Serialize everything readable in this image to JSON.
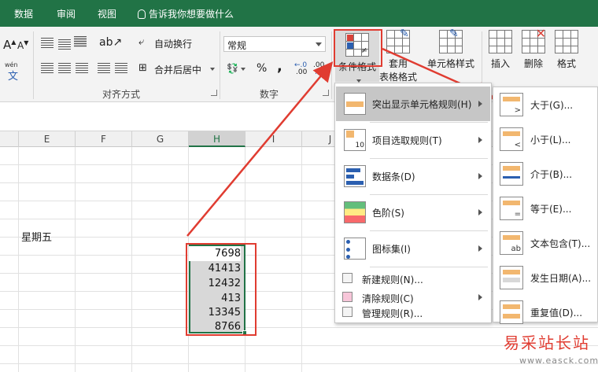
{
  "tabs": [
    "数据",
    "审阅",
    "视图"
  ],
  "tell_me": "告诉我你想要做什么",
  "ribbon": {
    "alignment": {
      "wrap_text": "自动换行",
      "merge_center": "合并后居中",
      "label": "对齐方式",
      "phonetic": "wén"
    },
    "number": {
      "format": "常规",
      "percent": "%",
      "comma": ",",
      "inc_decimal": ".00",
      "dec_decimal": ".0",
      "label": "数字"
    },
    "styles": {
      "conditional": "条件格式",
      "table_line1": "套用",
      "table_line2": "表格格式",
      "cell_styles": "单元格样式"
    },
    "cells": {
      "insert": "插入",
      "delete": "删除",
      "format": "格式"
    }
  },
  "columns": [
    "E",
    "F",
    "G",
    "H",
    "I",
    "J"
  ],
  "sheet": {
    "day": "星期五",
    "values": [
      "7698",
      "41413",
      "12432",
      "413",
      "13345",
      "8766"
    ]
  },
  "menu": {
    "items": [
      {
        "label": "突出显示单元格规则(H)",
        "icon": "highlight-rules-icon"
      },
      {
        "label": "项目选取规则(T)",
        "icon": "top-bottom-rules-icon"
      },
      {
        "label": "数据条(D)",
        "icon": "data-bars-icon"
      },
      {
        "label": "色阶(S)",
        "icon": "color-scales-icon"
      },
      {
        "label": "图标集(I)",
        "icon": "icon-sets-icon"
      }
    ],
    "small_items": [
      {
        "label": "新建规则(N)..."
      },
      {
        "label": "清除规则(C)"
      },
      {
        "label": "管理规则(R)..."
      }
    ]
  },
  "submenu": {
    "items": [
      {
        "label": "大于(G)...",
        "symbol": ">"
      },
      {
        "label": "小于(L)...",
        "symbol": "<"
      },
      {
        "label": "介于(B)...",
        "symbol": ""
      },
      {
        "label": "等于(E)...",
        "symbol": "="
      },
      {
        "label": "文本包含(T)...",
        "symbol": "ab"
      },
      {
        "label": "发生日期(A)...",
        "symbol": ""
      },
      {
        "label": "重复值(D)...",
        "symbol": ""
      }
    ]
  },
  "watermark": {
    "text": "易采站长站",
    "url": "www.easck.com"
  },
  "colors": {
    "excel_green": "#217346",
    "annotation_red": "#e03c31",
    "highlight_orange": "#f2b76f"
  }
}
